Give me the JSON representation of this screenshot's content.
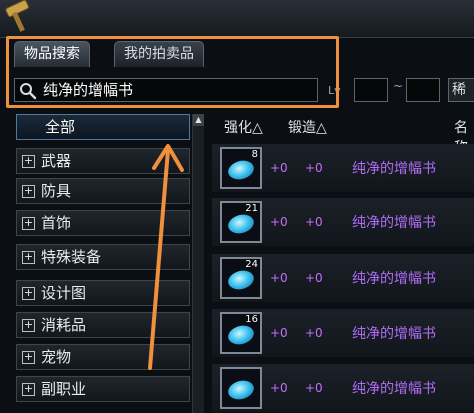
{
  "tabs": [
    {
      "label": "物品搜索",
      "active": true
    },
    {
      "label": "我的拍卖品",
      "active": false
    }
  ],
  "search": {
    "value": "纯净的增幅书",
    "level_label": "Lv",
    "level_sep": "~",
    "level_min": "",
    "level_max": "",
    "rarity_label": "稀有"
  },
  "categories": [
    {
      "label": "全部",
      "expandable": false,
      "selected": true
    },
    {
      "label": "武器",
      "expandable": true
    },
    {
      "label": "防具",
      "expandable": true
    },
    {
      "label": "首饰",
      "expandable": true
    },
    {
      "label": "特殊装备",
      "expandable": true
    },
    {
      "label": "设计图",
      "expandable": true
    },
    {
      "label": "消耗品",
      "expandable": true
    },
    {
      "label": "宠物",
      "expandable": true
    },
    {
      "label": "副职业",
      "expandable": true
    }
  ],
  "expand_symbol": "+",
  "scroll_up": "▲",
  "list": {
    "headers": {
      "strength": "强化△",
      "forge": "锻造△",
      "name": "名称"
    },
    "rows": [
      {
        "count": "8",
        "strength": "+0",
        "forge": "+0",
        "name": "纯净的增幅书"
      },
      {
        "count": "21",
        "strength": "+0",
        "forge": "+0",
        "name": "纯净的增幅书"
      },
      {
        "count": "24",
        "strength": "+0",
        "forge": "+0",
        "name": "纯净的增幅书"
      },
      {
        "count": "16",
        "strength": "+0",
        "forge": "+0",
        "name": "纯净的增幅书"
      },
      {
        "count": "",
        "strength": "+0",
        "forge": "+0",
        "name": "纯净的增幅书"
      }
    ]
  },
  "colors": {
    "highlight": "#f08f3c",
    "item_value": "#c86cff",
    "item_name": "#b06cf6"
  }
}
